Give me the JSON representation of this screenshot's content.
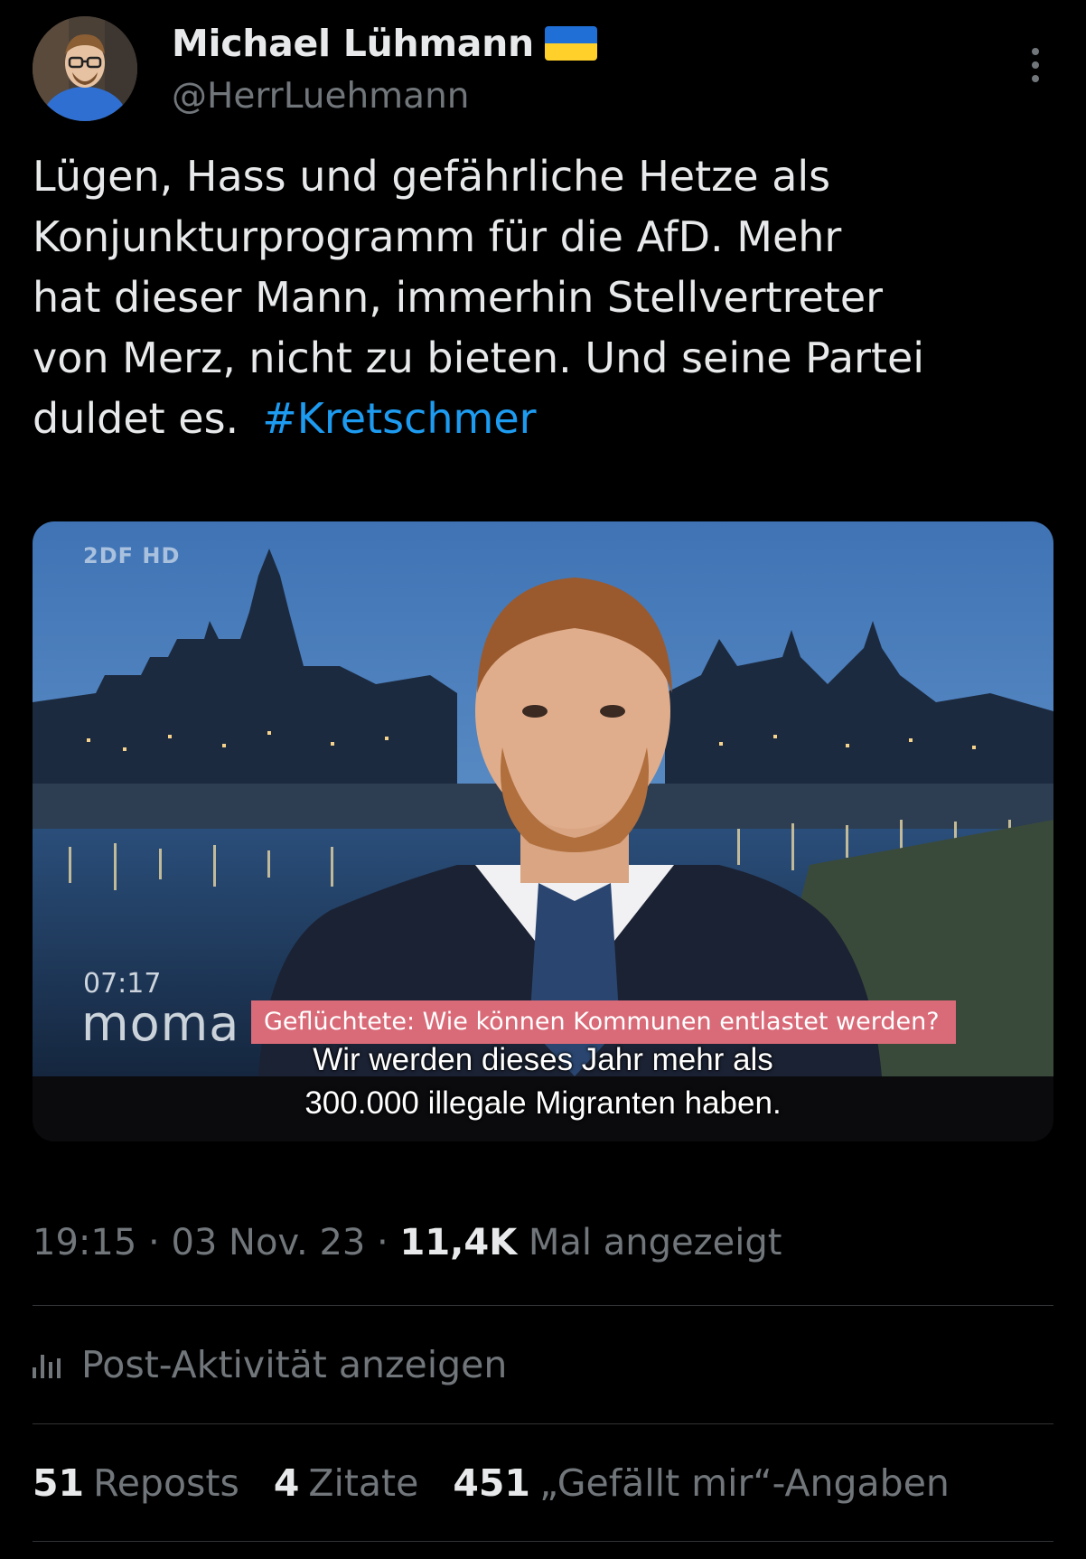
{
  "author": {
    "display_name": "Michael Lühmann",
    "handle": "@HerrLuehmann",
    "flag_icon": "ukraine-flag-icon"
  },
  "tweet": {
    "lines": [
      "Lügen, Hass und gefährliche Hetze als",
      "Konjunkturprogramm für die AfD. Mehr",
      "hat dieser Mann, immerhin Stellvertreter",
      "von Merz, nicht zu bieten. Und seine Partei"
    ],
    "last_line": "duldet es.",
    "hashtag": "#Kretschmer"
  },
  "media": {
    "channel_logo": "2DF HD",
    "clock": "07:17",
    "show_logo": "moma",
    "banner": "Geflüchtete: Wie können Kommunen entlastet werden?",
    "subtitle_line1": "Wir werden dieses Jahr mehr als",
    "subtitle_line2": "300.000 illegale Migranten haben."
  },
  "meta": {
    "time": "19:15",
    "sep1": " · ",
    "date": "03 Nov. 23",
    "sep2": " · ",
    "views_count": "11,4K",
    "views_label": " Mal angezeigt"
  },
  "activity": {
    "label": "Post-Aktivität anzeigen",
    "icon": "bar-chart-icon"
  },
  "stats": {
    "reposts_count": "51",
    "reposts_label": "Reposts",
    "quotes_count": "4",
    "quotes_label": "Zitate",
    "likes_count": "451",
    "likes_label": "„Gefällt mir“-Angaben"
  },
  "colors": {
    "background": "#000000",
    "text": "#e7e9ea",
    "muted": "#71767b",
    "link": "#1d9bf0",
    "divider": "#2f3336",
    "banner": "#d96a78"
  }
}
